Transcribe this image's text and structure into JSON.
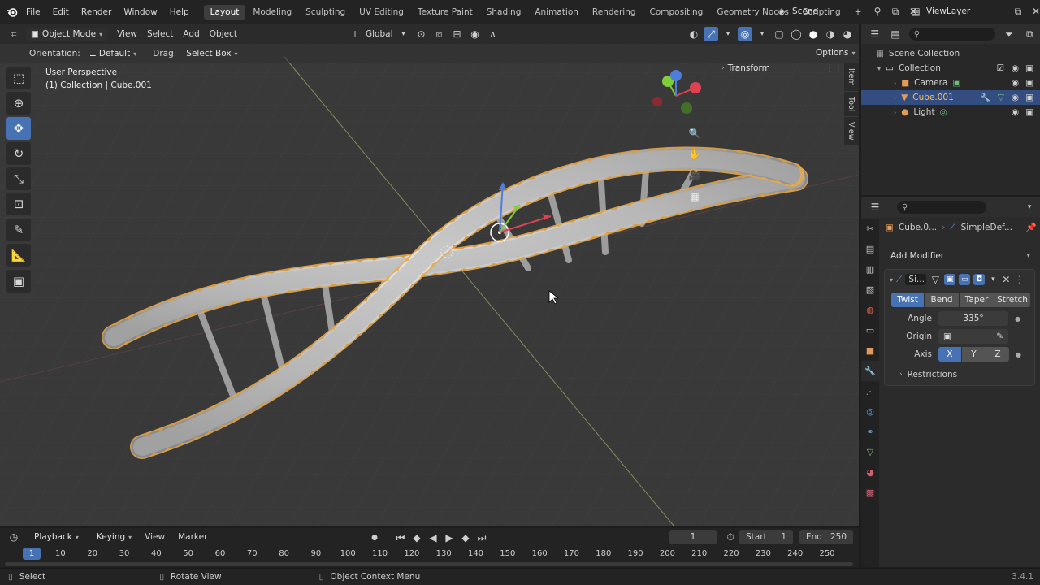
{
  "menus": [
    "File",
    "Edit",
    "Render",
    "Window",
    "Help"
  ],
  "workspaces": [
    {
      "label": "Layout",
      "active": true
    },
    {
      "label": "Modeling"
    },
    {
      "label": "Sculpting"
    },
    {
      "label": "UV Editing"
    },
    {
      "label": "Texture Paint"
    },
    {
      "label": "Shading"
    },
    {
      "label": "Animation"
    },
    {
      "label": "Rendering"
    },
    {
      "label": "Compositing"
    },
    {
      "label": "Geometry Nodes"
    },
    {
      "label": "Scripting"
    }
  ],
  "add_workspace": "+",
  "scene": "Scene",
  "view_layer": "ViewLayer",
  "viewport_header": {
    "mode": "Object Mode",
    "menus": [
      "View",
      "Select",
      "Add",
      "Object"
    ],
    "transform_orientation": "Global"
  },
  "tool_header": {
    "orientation_label": "Orientation:",
    "orientation_value": "Default",
    "drag_label": "Drag:",
    "drag_value": "Select Box",
    "options": "Options"
  },
  "overlay": {
    "view_name": "User Perspective",
    "collection_info": "(1) Collection | Cube.001",
    "transform_panel": "Transform"
  },
  "side_tabs": [
    "Item",
    "Tool",
    "View"
  ],
  "outliner": {
    "root": "Scene Collection",
    "collection": "Collection",
    "items": [
      {
        "name": "Camera"
      },
      {
        "name": "Cube.001",
        "selected": true
      },
      {
        "name": "Light"
      }
    ]
  },
  "properties": {
    "object": "Cube.0...",
    "modifier_crumb": "SimpleDef...",
    "add_modifier": "Add Modifier",
    "modifier_name": "Si...",
    "modes": [
      {
        "label": "Twist",
        "active": true
      },
      {
        "label": "Bend"
      },
      {
        "label": "Taper"
      },
      {
        "label": "Stretch"
      }
    ],
    "angle_label": "Angle",
    "angle_value": "335°",
    "origin_label": "Origin",
    "axis_label": "Axis",
    "axes": [
      {
        "label": "X",
        "active": true
      },
      {
        "label": "Y"
      },
      {
        "label": "Z"
      }
    ],
    "restrictions": "Restrictions"
  },
  "timeline": {
    "menus": [
      "Playback",
      "Keying",
      "View",
      "Marker"
    ],
    "current_frame": "1",
    "start_label": "Start",
    "start_value": "1",
    "end_label": "End",
    "end_value": "250",
    "ticks": [
      "1",
      "10",
      "20",
      "30",
      "40",
      "50",
      "60",
      "70",
      "80",
      "90",
      "100",
      "110",
      "120",
      "130",
      "140",
      "150",
      "160",
      "170",
      "180",
      "190",
      "200",
      "210",
      "220",
      "230",
      "240",
      "250"
    ]
  },
  "statusbar": {
    "select": "Select",
    "rotate": "Rotate View",
    "context": "Object Context Menu",
    "version": "3.4.1"
  },
  "colors": {
    "accent": "#4772b3",
    "selection_outline": "#e8a94a",
    "mesh": "#bfbfbf"
  }
}
